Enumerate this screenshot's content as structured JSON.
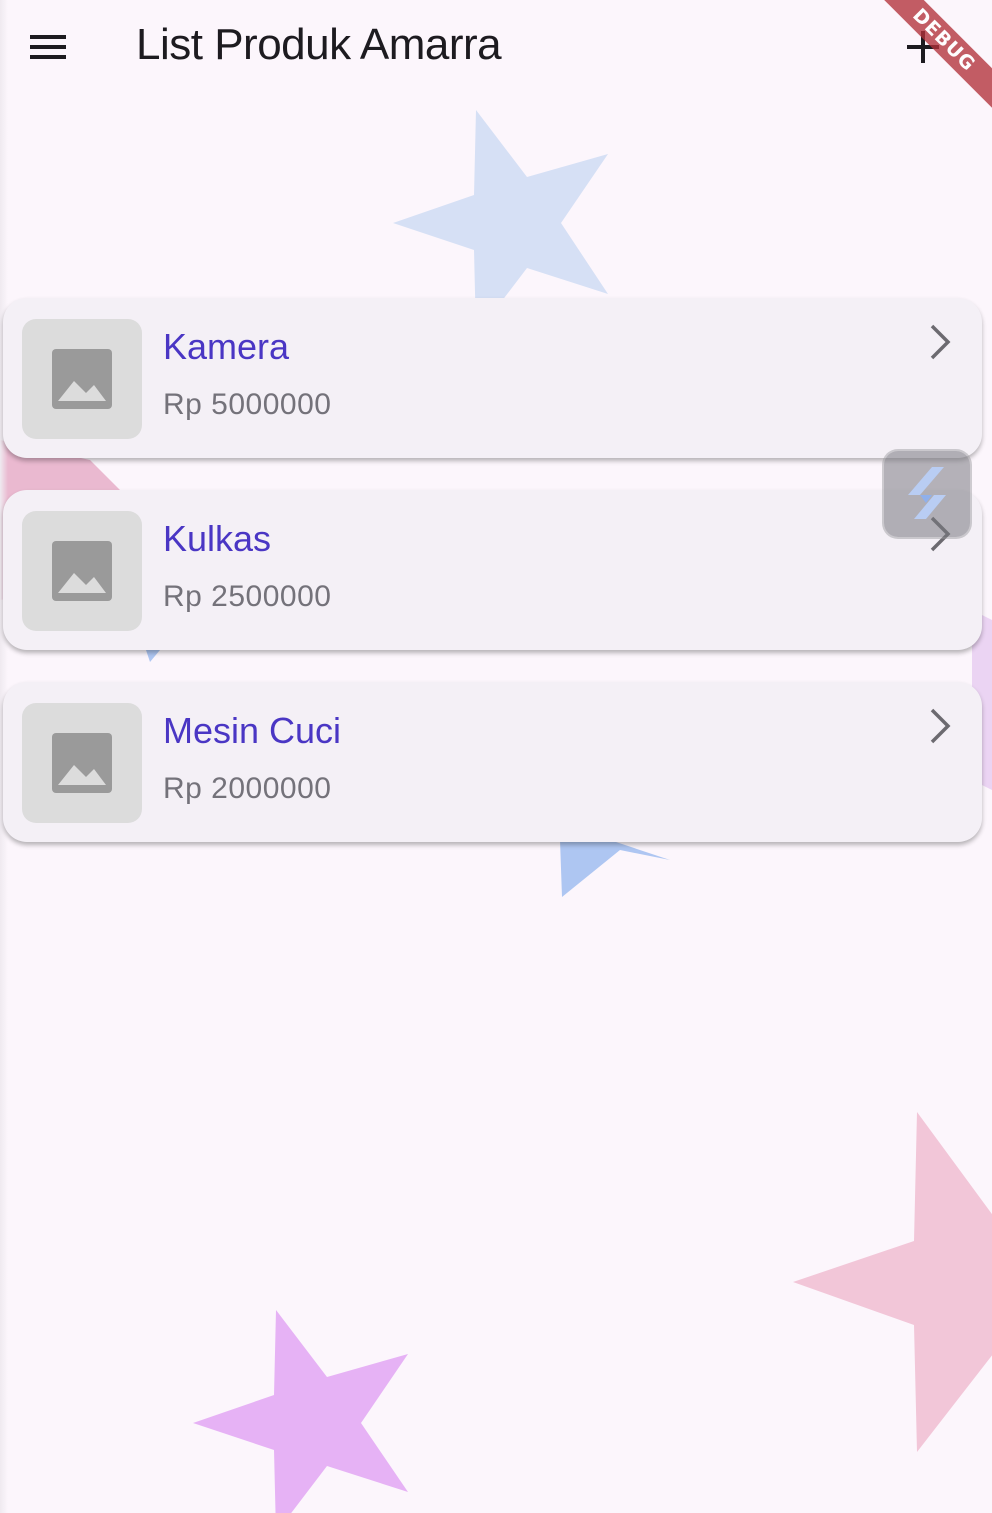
{
  "appbar": {
    "title": "List Produk Amarra",
    "menu_icon": "menu-icon",
    "add_icon": "add-icon"
  },
  "debug_banner": {
    "label": "DEBUG",
    "color": "#b3323a"
  },
  "products": [
    {
      "name": "Kamera",
      "price": "Rp 5000000",
      "image_icon": "image-placeholder-icon",
      "action_icon": "chevron-right-icon"
    },
    {
      "name": "Kulkas",
      "price": "Rp 2500000",
      "image_icon": "image-placeholder-icon",
      "action_icon": "chevron-right-icon"
    },
    {
      "name": "Mesin Cuci",
      "price": "Rp 2000000",
      "image_icon": "image-placeholder-icon",
      "action_icon": "chevron-right-icon"
    }
  ],
  "floating_button": {
    "icon": "flutter-inspector-icon"
  },
  "colors": {
    "background": "#fcf6fc",
    "card": "#f4f0f6",
    "product_name": "#4a36c4",
    "price": "#74727a",
    "star_blue": "#d6e0f5",
    "star_pink": "#f2c6d8",
    "star_purple": "#e6b2f5"
  }
}
